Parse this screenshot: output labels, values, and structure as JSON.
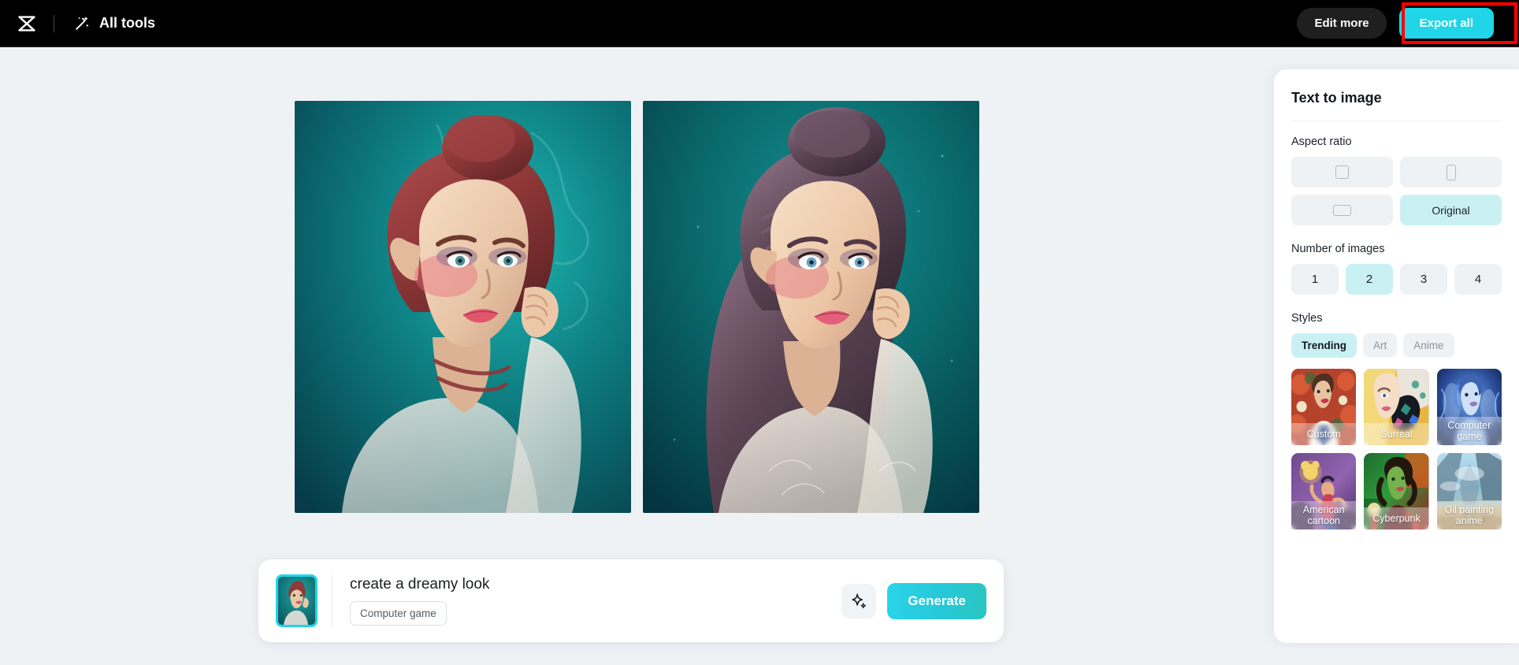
{
  "header": {
    "logo_icon": "capcut-logo-icon",
    "all_tools_label": "All tools",
    "all_tools_icon": "magic-wand-icon",
    "edit_more_label": "Edit more",
    "export_all_label": "Export all",
    "export_all_color": "#20d5e8",
    "annotation_color": "#ff0000"
  },
  "canvas": {
    "background": "#eff2f5",
    "images": [
      {
        "alt": "generated-portrait-red-hair",
        "bg_color": "#0d7b7e",
        "hair_color": "#8f3a38"
      },
      {
        "alt": "generated-portrait-purple-hair",
        "bg_color": "#0b5f62",
        "hair_color": "#5a4050"
      }
    ]
  },
  "prompt_bar": {
    "thumbnail_alt": "source-image-thumbnail",
    "thumbnail_border_color": "#20d5e8",
    "prompt_text": "create a dreamy look",
    "style_tag": "Computer game",
    "enhance_icon": "sparkle-icon",
    "generate_label": "Generate",
    "generate_color": "#25c8d8"
  },
  "panel": {
    "title": "Text to image",
    "aspect_ratio": {
      "label": "Aspect ratio",
      "options": [
        {
          "id": "square",
          "icon": "square-ratio-icon",
          "label": "",
          "selected": false
        },
        {
          "id": "portrait",
          "icon": "portrait-ratio-icon",
          "label": "",
          "selected": false
        },
        {
          "id": "landscape",
          "icon": "landscape-ratio-icon",
          "label": "",
          "selected": false
        },
        {
          "id": "original",
          "icon": "",
          "label": "Original",
          "selected": true
        }
      ]
    },
    "number_of_images": {
      "label": "Number of images",
      "options": [
        "1",
        "2",
        "3",
        "4"
      ],
      "selected": "2"
    },
    "styles": {
      "label": "Styles",
      "tabs": [
        {
          "label": "Trending",
          "selected": true
        },
        {
          "label": "Art",
          "selected": false
        },
        {
          "label": "Anime",
          "selected": false
        }
      ],
      "cards": [
        {
          "label": "Custom",
          "selected": false
        },
        {
          "label": "Surreal",
          "selected": false
        },
        {
          "label": "Computer game",
          "selected": true
        },
        {
          "label": "American cartoon",
          "selected": false
        },
        {
          "label": "Cyberpunk",
          "selected": false
        },
        {
          "label": "Oil painting anime",
          "selected": false
        }
      ],
      "selected_highlight_color": "#23d3e6"
    }
  }
}
